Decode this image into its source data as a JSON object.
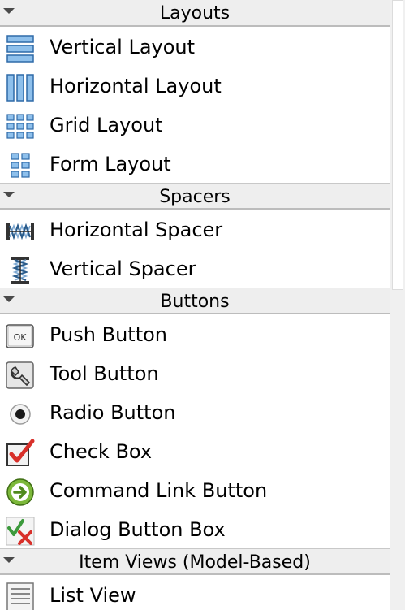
{
  "categories": [
    {
      "title": "Layouts",
      "items": [
        {
          "label": "Vertical Layout",
          "icon": "vertical-layout-icon"
        },
        {
          "label": "Horizontal Layout",
          "icon": "horizontal-layout-icon"
        },
        {
          "label": "Grid Layout",
          "icon": "grid-layout-icon"
        },
        {
          "label": "Form Layout",
          "icon": "form-layout-icon"
        }
      ]
    },
    {
      "title": "Spacers",
      "items": [
        {
          "label": "Horizontal Spacer",
          "icon": "horizontal-spacer-icon"
        },
        {
          "label": "Vertical Spacer",
          "icon": "vertical-spacer-icon"
        }
      ]
    },
    {
      "title": "Buttons",
      "items": [
        {
          "label": "Push Button",
          "icon": "push-button-icon",
          "icon_text": "OK"
        },
        {
          "label": "Tool Button",
          "icon": "tool-button-icon"
        },
        {
          "label": "Radio Button",
          "icon": "radio-button-icon"
        },
        {
          "label": "Check Box",
          "icon": "check-box-icon"
        },
        {
          "label": "Command Link Button",
          "icon": "command-link-button-icon"
        },
        {
          "label": "Dialog Button Box",
          "icon": "dialog-button-box-icon"
        }
      ]
    },
    {
      "title": "Item Views (Model-Based)",
      "items": [
        {
          "label": "List View",
          "icon": "list-view-icon"
        }
      ]
    }
  ],
  "colors": {
    "header_bg": "#eeeeee",
    "layout_icon_blue": "#4a86c8",
    "check_red": "#d8302a",
    "command_link_green": "#6aa82a"
  }
}
